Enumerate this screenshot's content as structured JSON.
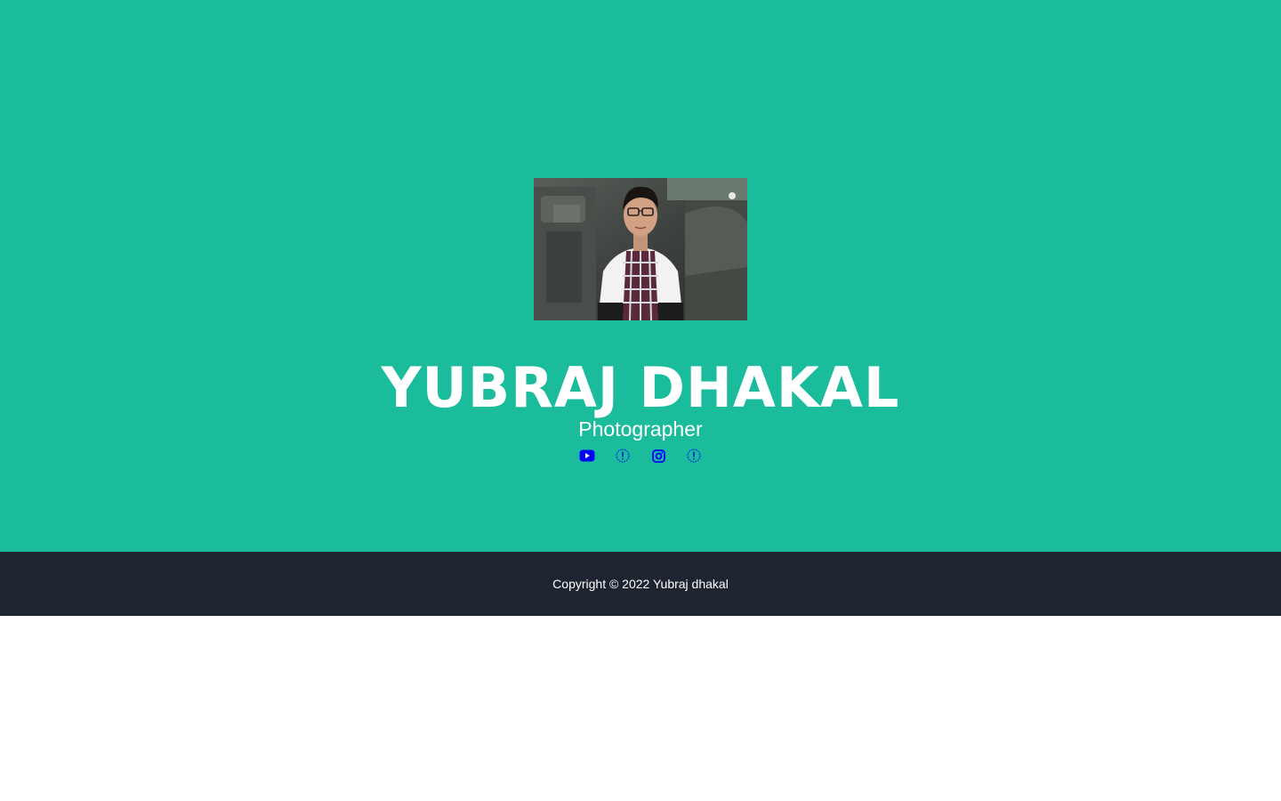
{
  "hero": {
    "background_color": "#1abc9c",
    "photo_alt": "Yubraj Dhakal",
    "name": "YUBRAJ DHAKAL",
    "role": "Photographer"
  },
  "socials": [
    {
      "icon": "youtube-icon",
      "color": "#0000ff"
    },
    {
      "icon": "missing-icon",
      "color": "#0000ff"
    },
    {
      "icon": "instagram-icon",
      "color": "#0000ff"
    },
    {
      "icon": "missing-icon",
      "color": "#0000ff"
    }
  ],
  "footer": {
    "background_color": "#1e2530",
    "copyright": "Copyright © 2022 Yubraj dhakal"
  }
}
